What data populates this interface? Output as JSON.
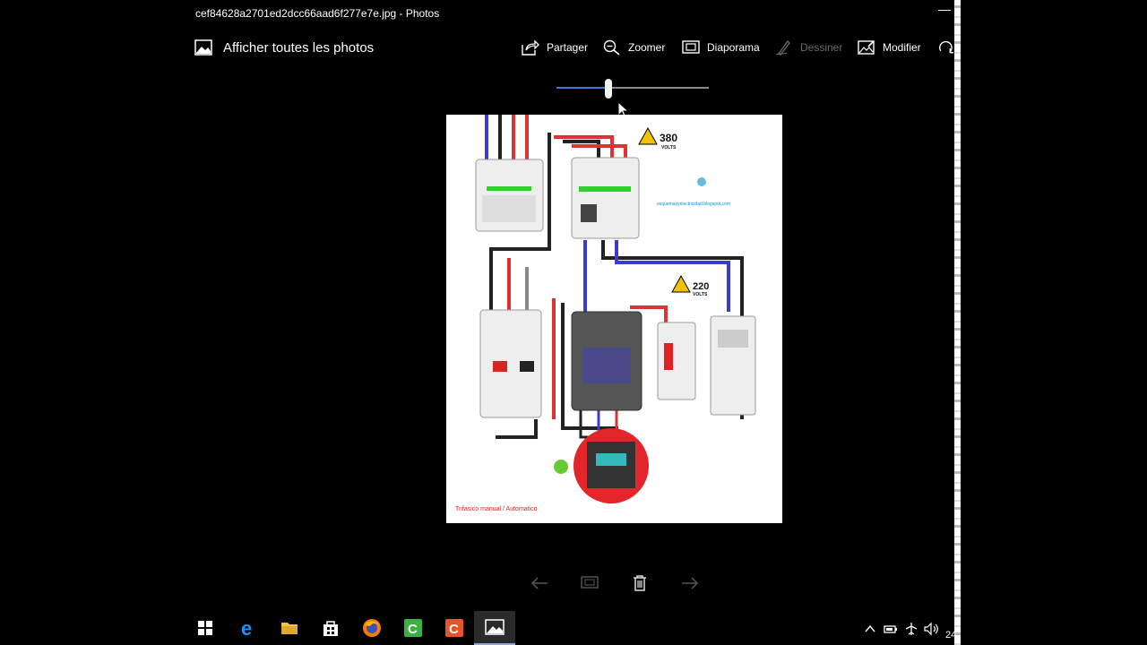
{
  "window": {
    "title": "cef84628a2701ed2dcc66aad6f277e7e.jpg - Photos",
    "minimize_glyph": "—"
  },
  "command_bar": {
    "back_label": "Afficher toutes les photos",
    "share_label": "Partager",
    "zoom_label": "Zoomer",
    "slideshow_label": "Diaporama",
    "draw_label": "Dessiner",
    "edit_label": "Modifier"
  },
  "zoom_slider": {
    "value": 0.34,
    "accent": "#3a7bd5"
  },
  "photo": {
    "volts_380": "380",
    "volts_380_unit": "VOLTS",
    "volts_220": "220",
    "volts_220_unit": "VOLTS",
    "caption": "Trifasico manual / Automatico",
    "url_text": "esquemasyelectricidad.blogspot.com"
  },
  "bottom_controls": {
    "prev_icon": "arrow-left-icon",
    "slideshow_icon": "slideshow-icon",
    "delete_icon": "trash-icon",
    "next_icon": "arrow-right-icon"
  },
  "taskbar": {
    "apps": [
      "start",
      "edge",
      "file-explorer",
      "store",
      "firefox",
      "camtasia-green",
      "camtasia-orange",
      "photos"
    ],
    "clock_partial": "24"
  }
}
